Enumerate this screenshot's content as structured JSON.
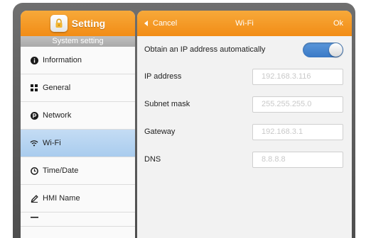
{
  "sidebar": {
    "app_title": "Setting",
    "section_label": "System setting",
    "items": [
      {
        "label": "Information",
        "icon": "info-icon"
      },
      {
        "label": "General",
        "icon": "grid-icon"
      },
      {
        "label": "Network",
        "icon": "network-icon"
      },
      {
        "label": "Wi-Fi",
        "icon": "wifi-icon",
        "active": true
      },
      {
        "label": "Time/Date",
        "icon": "clock-icon"
      },
      {
        "label": "HMI Name",
        "icon": "pen-icon"
      }
    ]
  },
  "header": {
    "cancel_label": "Cancel",
    "title": "Wi-Fi",
    "ok_label": "Ok"
  },
  "form": {
    "auto_ip_label": "Obtain an IP address automatically",
    "auto_ip_enabled": true,
    "ip_label": "IP address",
    "ip_placeholder": "192.168.3.116",
    "subnet_label": "Subnet mask",
    "subnet_placeholder": "255.255.255.0",
    "gateway_label": "Gateway",
    "gateway_placeholder": "192.168.3.1",
    "dns_label": "DNS",
    "dns_placeholder": "8.8.8.8"
  },
  "colors": {
    "accent_orange": "#f28c16",
    "active_blue": "#a9ccee",
    "toggle_blue": "#3a79c6"
  }
}
